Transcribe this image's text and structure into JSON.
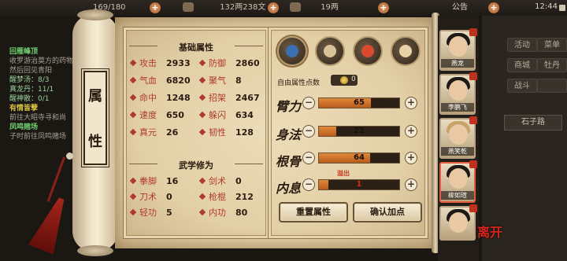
{
  "topbar": {
    "resource1": "169/180",
    "resource2": "132两238文",
    "resource3": "19两",
    "notice": "公告",
    "time": "12:44"
  },
  "questlog": {
    "items": [
      {
        "title": "回雁峰顶",
        "desc": "收罗游治莫方的药物，然后回见青阳"
      },
      {
        "title": "有情皆孽",
        "desc": "前往大昭寺寻和尚"
      },
      {
        "title": "凤鸣赌场",
        "desc": "子时前往凤鸣赌场"
      }
    ],
    "sub": [
      "醒梦汤：8/3",
      "真龙丹：11/1",
      "醒神散：0/1"
    ]
  },
  "scroll_label": {
    "line1": "属",
    "line2": "性"
  },
  "basic": {
    "title": "基础属性",
    "stats": [
      {
        "name": "攻击",
        "value": "2933"
      },
      {
        "name": "防御",
        "value": "2860"
      },
      {
        "name": "气血",
        "value": "6820"
      },
      {
        "name": "聚气",
        "value": "8"
      },
      {
        "name": "命中",
        "value": "1248"
      },
      {
        "name": "招架",
        "value": "2467"
      },
      {
        "name": "速度",
        "value": "650"
      },
      {
        "name": "躲闪",
        "value": "634"
      },
      {
        "name": "真元",
        "value": "26"
      },
      {
        "name": "韧性",
        "value": "128"
      }
    ]
  },
  "martial": {
    "title": "武学修为",
    "stats": [
      {
        "name": "拳脚",
        "value": "16"
      },
      {
        "name": "剑术",
        "value": "0"
      },
      {
        "name": "刀术",
        "value": "0"
      },
      {
        "name": "枪棍",
        "value": "212"
      },
      {
        "name": "轻功",
        "value": "5"
      },
      {
        "name": "内功",
        "value": "80"
      }
    ]
  },
  "potential": {
    "free_label": "自由属性点数",
    "free_value": "0",
    "overflow": "溢出",
    "attributes": [
      {
        "label": "臂力",
        "value": "65",
        "fill": 0.65
      },
      {
        "label": "身法",
        "value": "22",
        "fill": 0.22
      },
      {
        "label": "根骨",
        "value": "64",
        "fill": 0.64
      },
      {
        "label": "内息",
        "value": "1",
        "fill": 0.12
      }
    ],
    "minus": "−",
    "plus": "+"
  },
  "buttons": {
    "reset": "重置属性",
    "confirm": "确认加点"
  },
  "characters": [
    {
      "name": "燕龙"
    },
    {
      "name": "李鹏飞"
    },
    {
      "name": "燕笑乾"
    },
    {
      "name": "柳如瑄"
    },
    {
      "name": ""
    }
  ],
  "menu": {
    "items": [
      "活动",
      "菜单",
      "商城",
      "牡丹",
      "战斗",
      ""
    ],
    "location": "石子路"
  },
  "seal": "离开",
  "colors": {
    "accent": "#b03a2e",
    "parchment": "#e2cfa6",
    "bar": "#d57a30"
  }
}
